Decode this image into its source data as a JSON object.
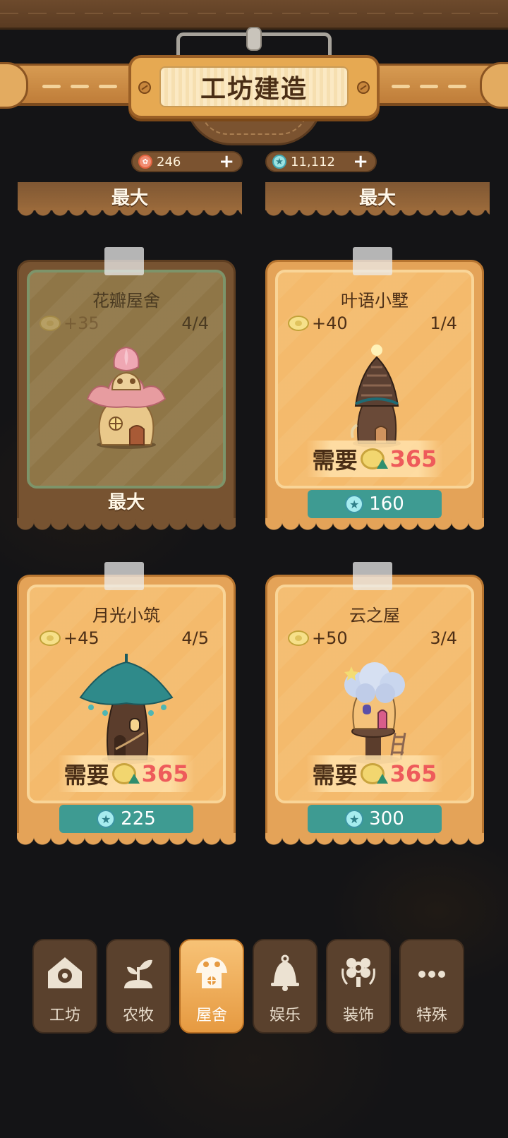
{
  "header": {
    "title": "工坊建造"
  },
  "currencies": [
    {
      "icon": "rose-icon",
      "value": "246",
      "plus": "+"
    },
    {
      "icon": "star-gem-icon",
      "value": "11,112",
      "plus": "+"
    }
  ],
  "top_strips": [
    "最大",
    "最大"
  ],
  "cards": [
    {
      "name": "花瓣屋舍",
      "bonus": "+35",
      "count": "4/4",
      "state": "max",
      "max_label": "最大"
    },
    {
      "name": "叶语小墅",
      "bonus": "+40",
      "count": "1/4",
      "need_label": "需要",
      "need_value": "365",
      "price": "160"
    },
    {
      "name": "月光小筑",
      "bonus": "+45",
      "count": "4/5",
      "need_label": "需要",
      "need_value": "365",
      "price": "225"
    },
    {
      "name": "云之屋",
      "bonus": "+50",
      "count": "3/4",
      "need_label": "需要",
      "need_value": "365",
      "price": "300"
    }
  ],
  "nav": {
    "items": [
      {
        "label": "工坊",
        "icon": "gear-house-icon"
      },
      {
        "label": "农牧",
        "icon": "sprout-icon"
      },
      {
        "label": "屋舍",
        "icon": "mushroom-house-icon",
        "active": true
      },
      {
        "label": "娱乐",
        "icon": "bell-icon"
      },
      {
        "label": "装饰",
        "icon": "flower-lantern-icon"
      },
      {
        "label": "特殊",
        "icon": "more-icon"
      }
    ]
  },
  "colors": {
    "accent": "#e69a41",
    "price_bg": "#3e9b92",
    "need_value": "#ee5b5b"
  }
}
